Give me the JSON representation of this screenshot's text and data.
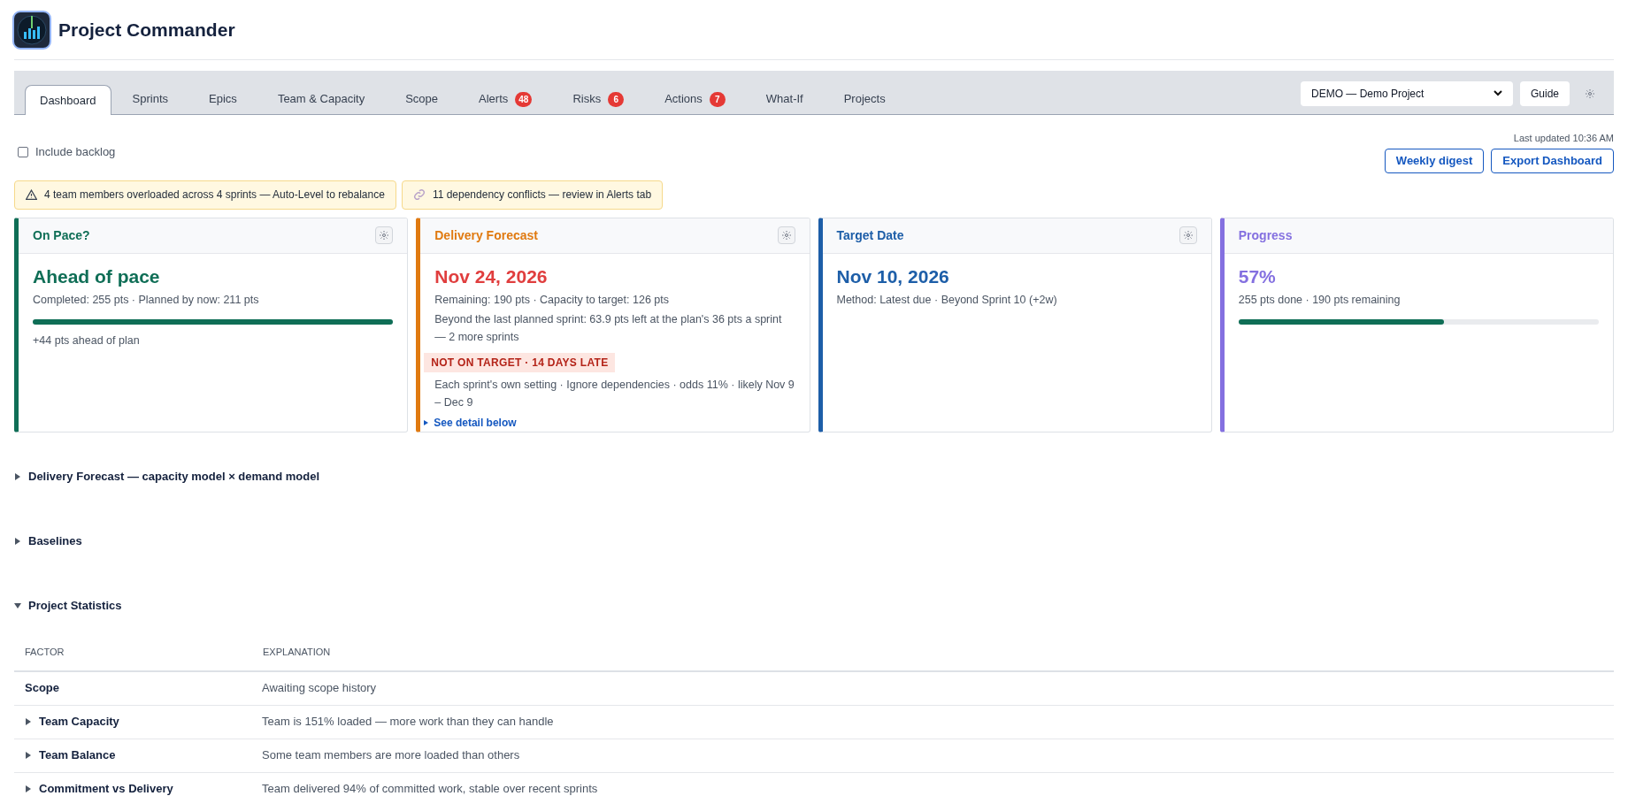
{
  "app": {
    "title": "Project Commander"
  },
  "tabs": [
    {
      "label": "Dashboard",
      "selected": true
    },
    {
      "label": "Sprints",
      "selected": false
    },
    {
      "label": "Epics",
      "selected": false
    },
    {
      "label": "Team & Capacity",
      "selected": false
    },
    {
      "label": "Scope",
      "selected": false
    },
    {
      "label": "Alerts",
      "selected": false,
      "badge": "48"
    },
    {
      "label": "Risks",
      "selected": false,
      "badge": "6"
    },
    {
      "label": "Actions",
      "selected": false,
      "badge": "7"
    },
    {
      "label": "What-If",
      "selected": false
    },
    {
      "label": "Projects",
      "selected": false
    }
  ],
  "project_select": {
    "value": "DEMO — Demo Project"
  },
  "guide_button": "Guide",
  "include_backlog": {
    "label": "Include backlog",
    "checked": false
  },
  "last_updated": "Last updated 10:36 AM",
  "actions": [
    "Weekly digest",
    "Export Dashboard"
  ],
  "alerts": [
    {
      "kind": "warning",
      "text": "4 team members overloaded across 4 sprints — Auto-Level to rebalance"
    },
    {
      "kind": "link",
      "text": "11 dependency conflicts — review in Alerts tab"
    }
  ],
  "cards": [
    {
      "title": "On Pace?",
      "color": "#0f6e56",
      "settings": true,
      "headline": "Ahead of pace",
      "lines": [
        "Completed: 255 pts · Planned by now: 211 pts"
      ],
      "level": 1,
      "note": "+44 pts ahead of plan"
    },
    {
      "title": "Delivery Forecast",
      "color": "#e07a10",
      "late": true,
      "settings": true,
      "headline": "Nov 24, 2026",
      "lines": [
        "Remaining: 190 pts · Capacity to target: 126 pts",
        "Beyond the last planned sprint: 63.9 pts left at the plan's 36 pts a sprint — 2 more sprints"
      ],
      "badge": "NOT ON TARGET · 14 DAYS LATE",
      "note": "Each sprint's own setting · Ignore dependencies · odds 11% · likely Nov 9 – Dec 9",
      "link": "See detail below"
    },
    {
      "title": "Target Date",
      "color": "#1d5ea8",
      "settings": true,
      "headline": "Nov 10, 2026",
      "lines": [
        "Method: Latest due · Beyond Sprint 10 (+2w)"
      ]
    },
    {
      "title": "Progress",
      "color": "#8470e0",
      "settings": false,
      "headline": "57%",
      "lines": [
        "255 pts done · 190 pts remaining"
      ],
      "level": 0.57
    }
  ],
  "sections": [
    {
      "title": "Delivery Forecast — capacity model × demand model",
      "expanded": false
    },
    {
      "title": "Baselines",
      "expanded": false
    },
    {
      "title": "Project Statistics",
      "expanded": true
    }
  ],
  "table": {
    "columns": [
      "FACTOR",
      "EXPLANATION"
    ],
    "rows": [
      {
        "factor": "Scope",
        "explanation": "Awaiting scope history",
        "expandable": false
      },
      {
        "factor": "Team Capacity",
        "explanation": "Team is 151% loaded — more work than they can handle",
        "expandable": true
      },
      {
        "factor": "Team Balance",
        "explanation": "Some team members are more loaded than others",
        "expandable": true
      },
      {
        "factor": "Commitment vs Delivery",
        "explanation": "Team delivered 94% of committed work, stable over recent sprints",
        "expandable": true
      }
    ]
  }
}
